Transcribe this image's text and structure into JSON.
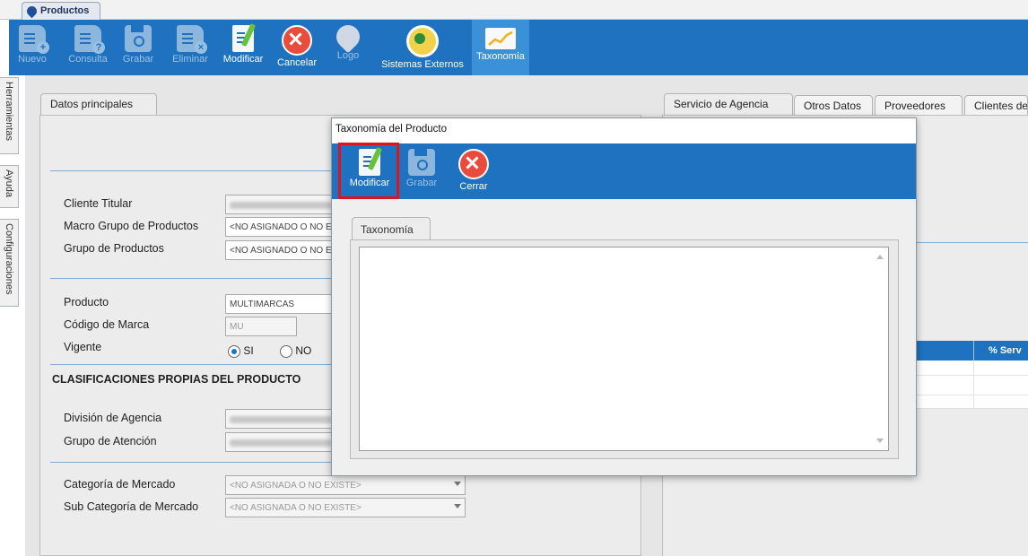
{
  "window_tab": {
    "label": "Productos",
    "icon": "product-icon"
  },
  "toolbar": {
    "buttons": [
      {
        "label": "Nuevo",
        "icon": "new-document-icon",
        "enabled": false
      },
      {
        "label": "Consulta",
        "icon": "query-document-icon",
        "enabled": false
      },
      {
        "label": "Grabar",
        "icon": "save-icon",
        "enabled": false
      },
      {
        "label": "Eliminar",
        "icon": "delete-document-icon",
        "enabled": false
      },
      {
        "label": "Modificar",
        "icon": "edit-icon",
        "enabled": true
      },
      {
        "label": "Cancelar",
        "icon": "cancel-icon",
        "enabled": true
      },
      {
        "label": "Logo",
        "icon": "logo-icon",
        "enabled": false
      },
      {
        "label": "Sistemas Externos",
        "icon": "external-systems-icon",
        "enabled": true
      },
      {
        "label": "Taxonomía",
        "icon": "chart-icon",
        "enabled": true,
        "active": true
      }
    ]
  },
  "side_tabs": [
    "Herramientas",
    "Ayuda",
    "Configuraciones"
  ],
  "left_panel": {
    "tab": "Datos principales",
    "fields": {
      "cliente_titular": {
        "label": "Cliente Titular"
      },
      "macro_grupo": {
        "label": "Macro Grupo de Productos",
        "value": "<NO ASIGNADO O NO EXISTE>"
      },
      "grupo": {
        "label": "Grupo de Productos",
        "value": "<NO ASIGNADO O NO EXISTE>"
      },
      "producto": {
        "label": "Producto",
        "value": "MULTIMARCAS"
      },
      "codigo_marca": {
        "label": "Código de Marca",
        "value": "MU"
      },
      "vigente": {
        "label": "Vigente",
        "option_yes": "SI",
        "option_no": "NO",
        "selected": "SI"
      }
    },
    "section_title": "CLASIFICACIONES PROPIAS DEL PRODUCTO",
    "fields2": {
      "division": {
        "label": "División de Agencia"
      },
      "grupo_atencion": {
        "label": "Grupo de Atención"
      },
      "categoria": {
        "label": "Categoría de Mercado",
        "value": "<NO ASIGNADA O NO EXISTE>"
      },
      "subcategoria": {
        "label": "Sub Categoría de Mercado",
        "value": "<NO ASIGNADA O NO EXISTE>"
      }
    }
  },
  "right_panel": {
    "tabs": [
      "Servicio de Agencia",
      "Otros Datos",
      "Proveedores",
      "Clientes de"
    ],
    "grid_header": "% Serv"
  },
  "modal": {
    "title": "Taxonomía del Producto",
    "buttons": [
      {
        "label": "Modificar",
        "icon": "edit-icon",
        "enabled": true,
        "highlighted": true
      },
      {
        "label": "Grabar",
        "icon": "save-icon",
        "enabled": false
      },
      {
        "label": "Cerrar",
        "icon": "close-icon",
        "enabled": true
      }
    ],
    "tab": "Taxonomía",
    "text_value": ""
  },
  "colors": {
    "toolbar": "#1e72bf",
    "highlight": "#e0131b",
    "accent": "#3b91d8"
  }
}
